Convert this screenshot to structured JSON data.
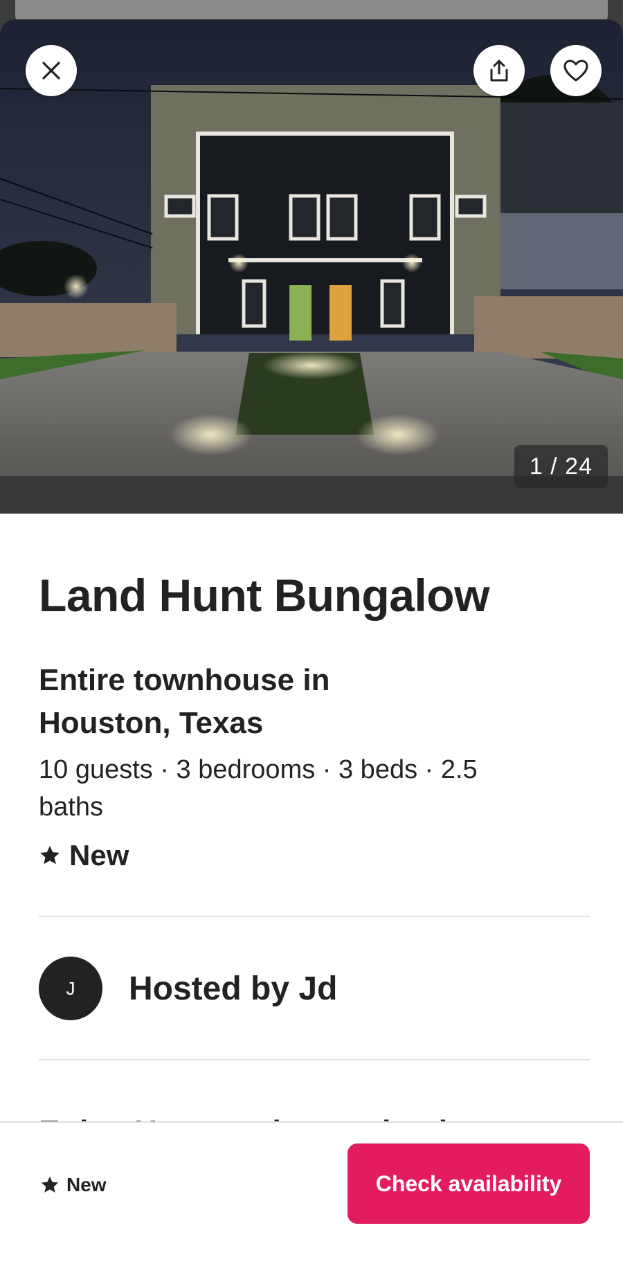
{
  "gallery": {
    "counter": "1 / 24",
    "image_alt": "Two-story dark townhouse at night with lit walkway"
  },
  "listing": {
    "title": "Land Hunt Bungalow",
    "subtitle": "Entire townhouse in Houston, Texas",
    "details": "10 guests · 3 bedrooms · 3 beds · 2.5 baths",
    "rating_label": "New"
  },
  "host": {
    "initial": "J",
    "label": "Hosted by Jd"
  },
  "description_peek": "Enjoy Houston by staying in our",
  "footer": {
    "rating_label": "New",
    "cta_label": "Check availability"
  },
  "icons": {
    "close": "close-icon",
    "share": "share-icon",
    "favorite": "heart-icon",
    "rating": "star-icon"
  },
  "colors": {
    "accent": "#e31c5f",
    "text": "#222222",
    "divider": "#e2e2e2"
  }
}
